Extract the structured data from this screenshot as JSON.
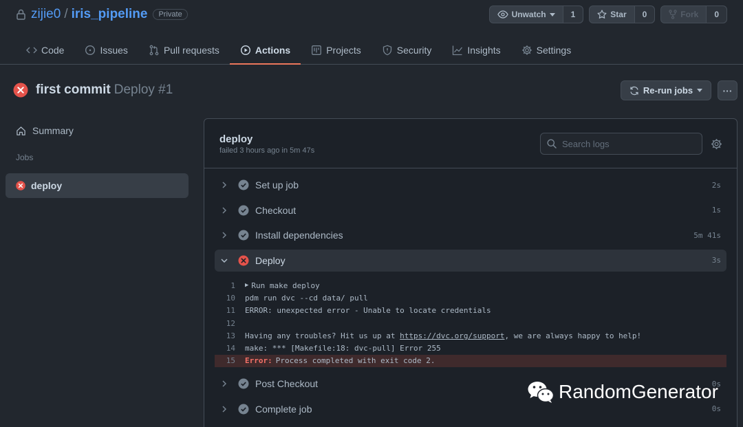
{
  "repo": {
    "owner": "zijie0",
    "separator": "/",
    "name": "iris_pipeline",
    "visibility": "Private"
  },
  "actions": {
    "unwatch": {
      "label": "Unwatch",
      "count": "1"
    },
    "star": {
      "label": "Star",
      "count": "0"
    },
    "fork": {
      "label": "Fork",
      "count": "0"
    }
  },
  "nav": {
    "code": "Code",
    "issues": "Issues",
    "pulls": "Pull requests",
    "actions": "Actions",
    "projects": "Projects",
    "security": "Security",
    "insights": "Insights",
    "settings": "Settings"
  },
  "run": {
    "commit": "first commit",
    "workflow": "Deploy #1",
    "rerun_label": "Re-run jobs",
    "more_label": "···"
  },
  "sidebar": {
    "summary": "Summary",
    "jobs_heading": "Jobs",
    "job": "deploy"
  },
  "job": {
    "name": "deploy",
    "meta": "failed 3 hours ago in 5m 47s",
    "search_placeholder": "Search logs"
  },
  "steps": [
    {
      "name": "Set up job",
      "duration": "2s",
      "status": "success"
    },
    {
      "name": "Checkout",
      "duration": "1s",
      "status": "success"
    },
    {
      "name": "Install dependencies",
      "duration": "5m 41s",
      "status": "success"
    },
    {
      "name": "Deploy",
      "duration": "3s",
      "status": "failure"
    },
    {
      "name": "Post Checkout",
      "duration": "0s",
      "status": "success"
    },
    {
      "name": "Complete job",
      "duration": "0s",
      "status": "success"
    }
  ],
  "log": {
    "l1": {
      "num": "1",
      "text": "Run make deploy"
    },
    "l10": {
      "num": "10",
      "text": "pdm run dvc --cd data/ pull"
    },
    "l11": {
      "num": "11",
      "text": "ERROR: unexpected error - Unable to locate credentials"
    },
    "l12": {
      "num": "12",
      "text": ""
    },
    "l13": {
      "num": "13",
      "pre": "Having any troubles? Hit us up at ",
      "link": "https://dvc.org/support",
      "post": ", we are always happy to help!"
    },
    "l14": {
      "num": "14",
      "text": "make: *** [Makefile:18: dvc-pull] Error 255"
    },
    "l15": {
      "num": "15",
      "label": "Error:",
      "text": "Process completed with exit code 2."
    }
  },
  "watermark": "RandomGenerator",
  "colors": {
    "background": "#22272e",
    "accent_link": "#539bf5",
    "failure": "#e5534b",
    "success": "#768390",
    "active_tab": "#ec775c"
  }
}
